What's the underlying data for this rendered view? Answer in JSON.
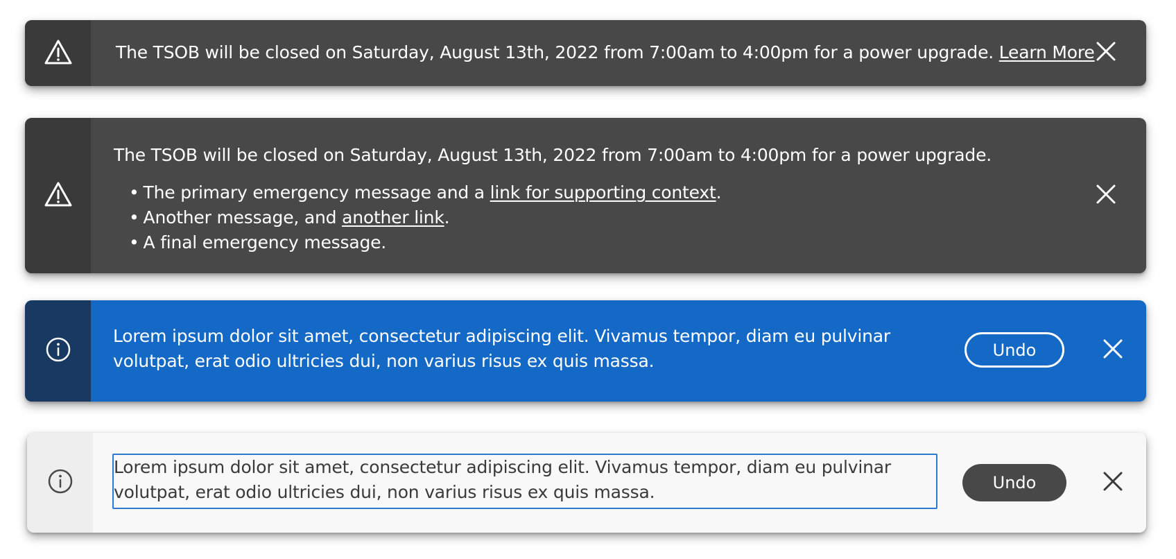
{
  "banners": [
    {
      "variant": "warning-dark",
      "icon": "warning-triangle-icon",
      "message": "The TSOB will be closed on Saturday, August 13th, 2022 from 7:00am to 4:00pm for a power upgrade. ",
      "link_label": "Learn More",
      "close_label": "Close"
    },
    {
      "variant": "warning-dark",
      "icon": "warning-triangle-icon",
      "message": "The TSOB will be closed on Saturday, August 13th, 2022 from 7:00am to 4:00pm for a power upgrade.",
      "bullets": [
        {
          "before": "The primary emergency message and a ",
          "link": "link for supporting context",
          "after": "."
        },
        {
          "before": "Another message, and ",
          "link": "another link",
          "after": "."
        },
        {
          "before": "A final emergency message.",
          "link": "",
          "after": ""
        }
      ],
      "close_label": "Close"
    },
    {
      "variant": "info-blue",
      "icon": "info-circle-icon",
      "message": "Lorem ipsum dolor sit amet, consectetur adipiscing elit. Vivamus tempor, diam eu pulvinar volutpat, erat odio ultricies dui, non varius risus ex quis massa.",
      "action_label": "Undo",
      "close_label": "Close"
    },
    {
      "variant": "info-light",
      "icon": "info-circle-icon",
      "message": "Lorem ipsum dolor sit amet, consectetur adipiscing elit. Vivamus tempor, diam eu pulvinar volutpat, erat odio ultricies dui, non varius risus ex quis massa.",
      "action_label": "Undo",
      "close_label": "Close"
    }
  ],
  "colors": {
    "dark_bg": "#484848",
    "dark_icon_bg": "#3a3a3a",
    "blue_bg": "#1469c6",
    "blue_icon_bg": "#183a62",
    "light_bg": "#f8f8f8",
    "light_icon_bg": "#eeeeee",
    "focus_ring": "#2d7bd1"
  }
}
